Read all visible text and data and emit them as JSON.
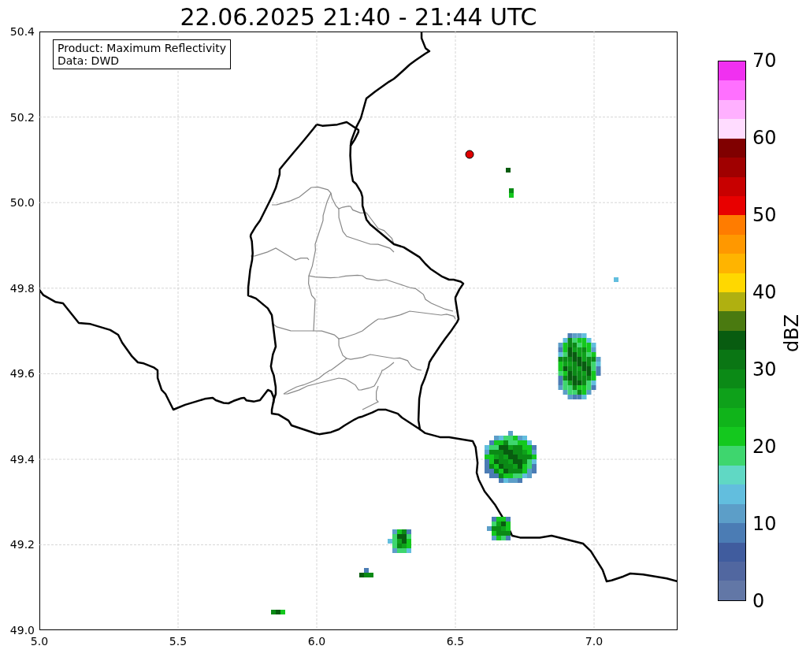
{
  "title": "22.06.2025 21:40 - 21:44 UTC",
  "info_box": {
    "lines": [
      "Product: Maximum Reflectivity",
      "Data: DWD"
    ]
  },
  "y_ticks": [
    "50.4",
    "50.2",
    "50.0",
    "49.8",
    "49.6",
    "49.4",
    "49.2",
    "49.0"
  ],
  "x_ticks": [
    "5.0",
    "5.5",
    "6.0",
    "6.5",
    "7.0"
  ],
  "colorbar": {
    "label": "dBZ",
    "ticks": [
      "70",
      "60",
      "50",
      "40",
      "30",
      "20",
      "10",
      "0"
    ],
    "bands": [
      {
        "color": "#6277a6"
      },
      {
        "color": "#5167a0"
      },
      {
        "color": "#405c9e"
      },
      {
        "color": "#4b7cb4"
      },
      {
        "color": "#5c9ec8"
      },
      {
        "color": "#62bede"
      },
      {
        "color": "#60d8c4"
      },
      {
        "color": "#3ed66e"
      },
      {
        "color": "#14c81e"
      },
      {
        "color": "#10b41a"
      },
      {
        "color": "#0ea11a"
      },
      {
        "color": "#0b8a16"
      },
      {
        "color": "#0a7614"
      },
      {
        "color": "#085c10"
      },
      {
        "color": "#4a7a10"
      },
      {
        "color": "#b0b010"
      },
      {
        "color": "#ffd800"
      },
      {
        "color": "#ffb400"
      },
      {
        "color": "#ff9800"
      },
      {
        "color": "#ff7c00"
      },
      {
        "color": "#e80000"
      },
      {
        "color": "#c80000"
      },
      {
        "color": "#a00000"
      },
      {
        "color": "#800000"
      },
      {
        "color": "#ffdcff"
      },
      {
        "color": "#ffb0ff"
      },
      {
        "color": "#ff70ff"
      },
      {
        "color": "#f030f0"
      }
    ]
  }
}
